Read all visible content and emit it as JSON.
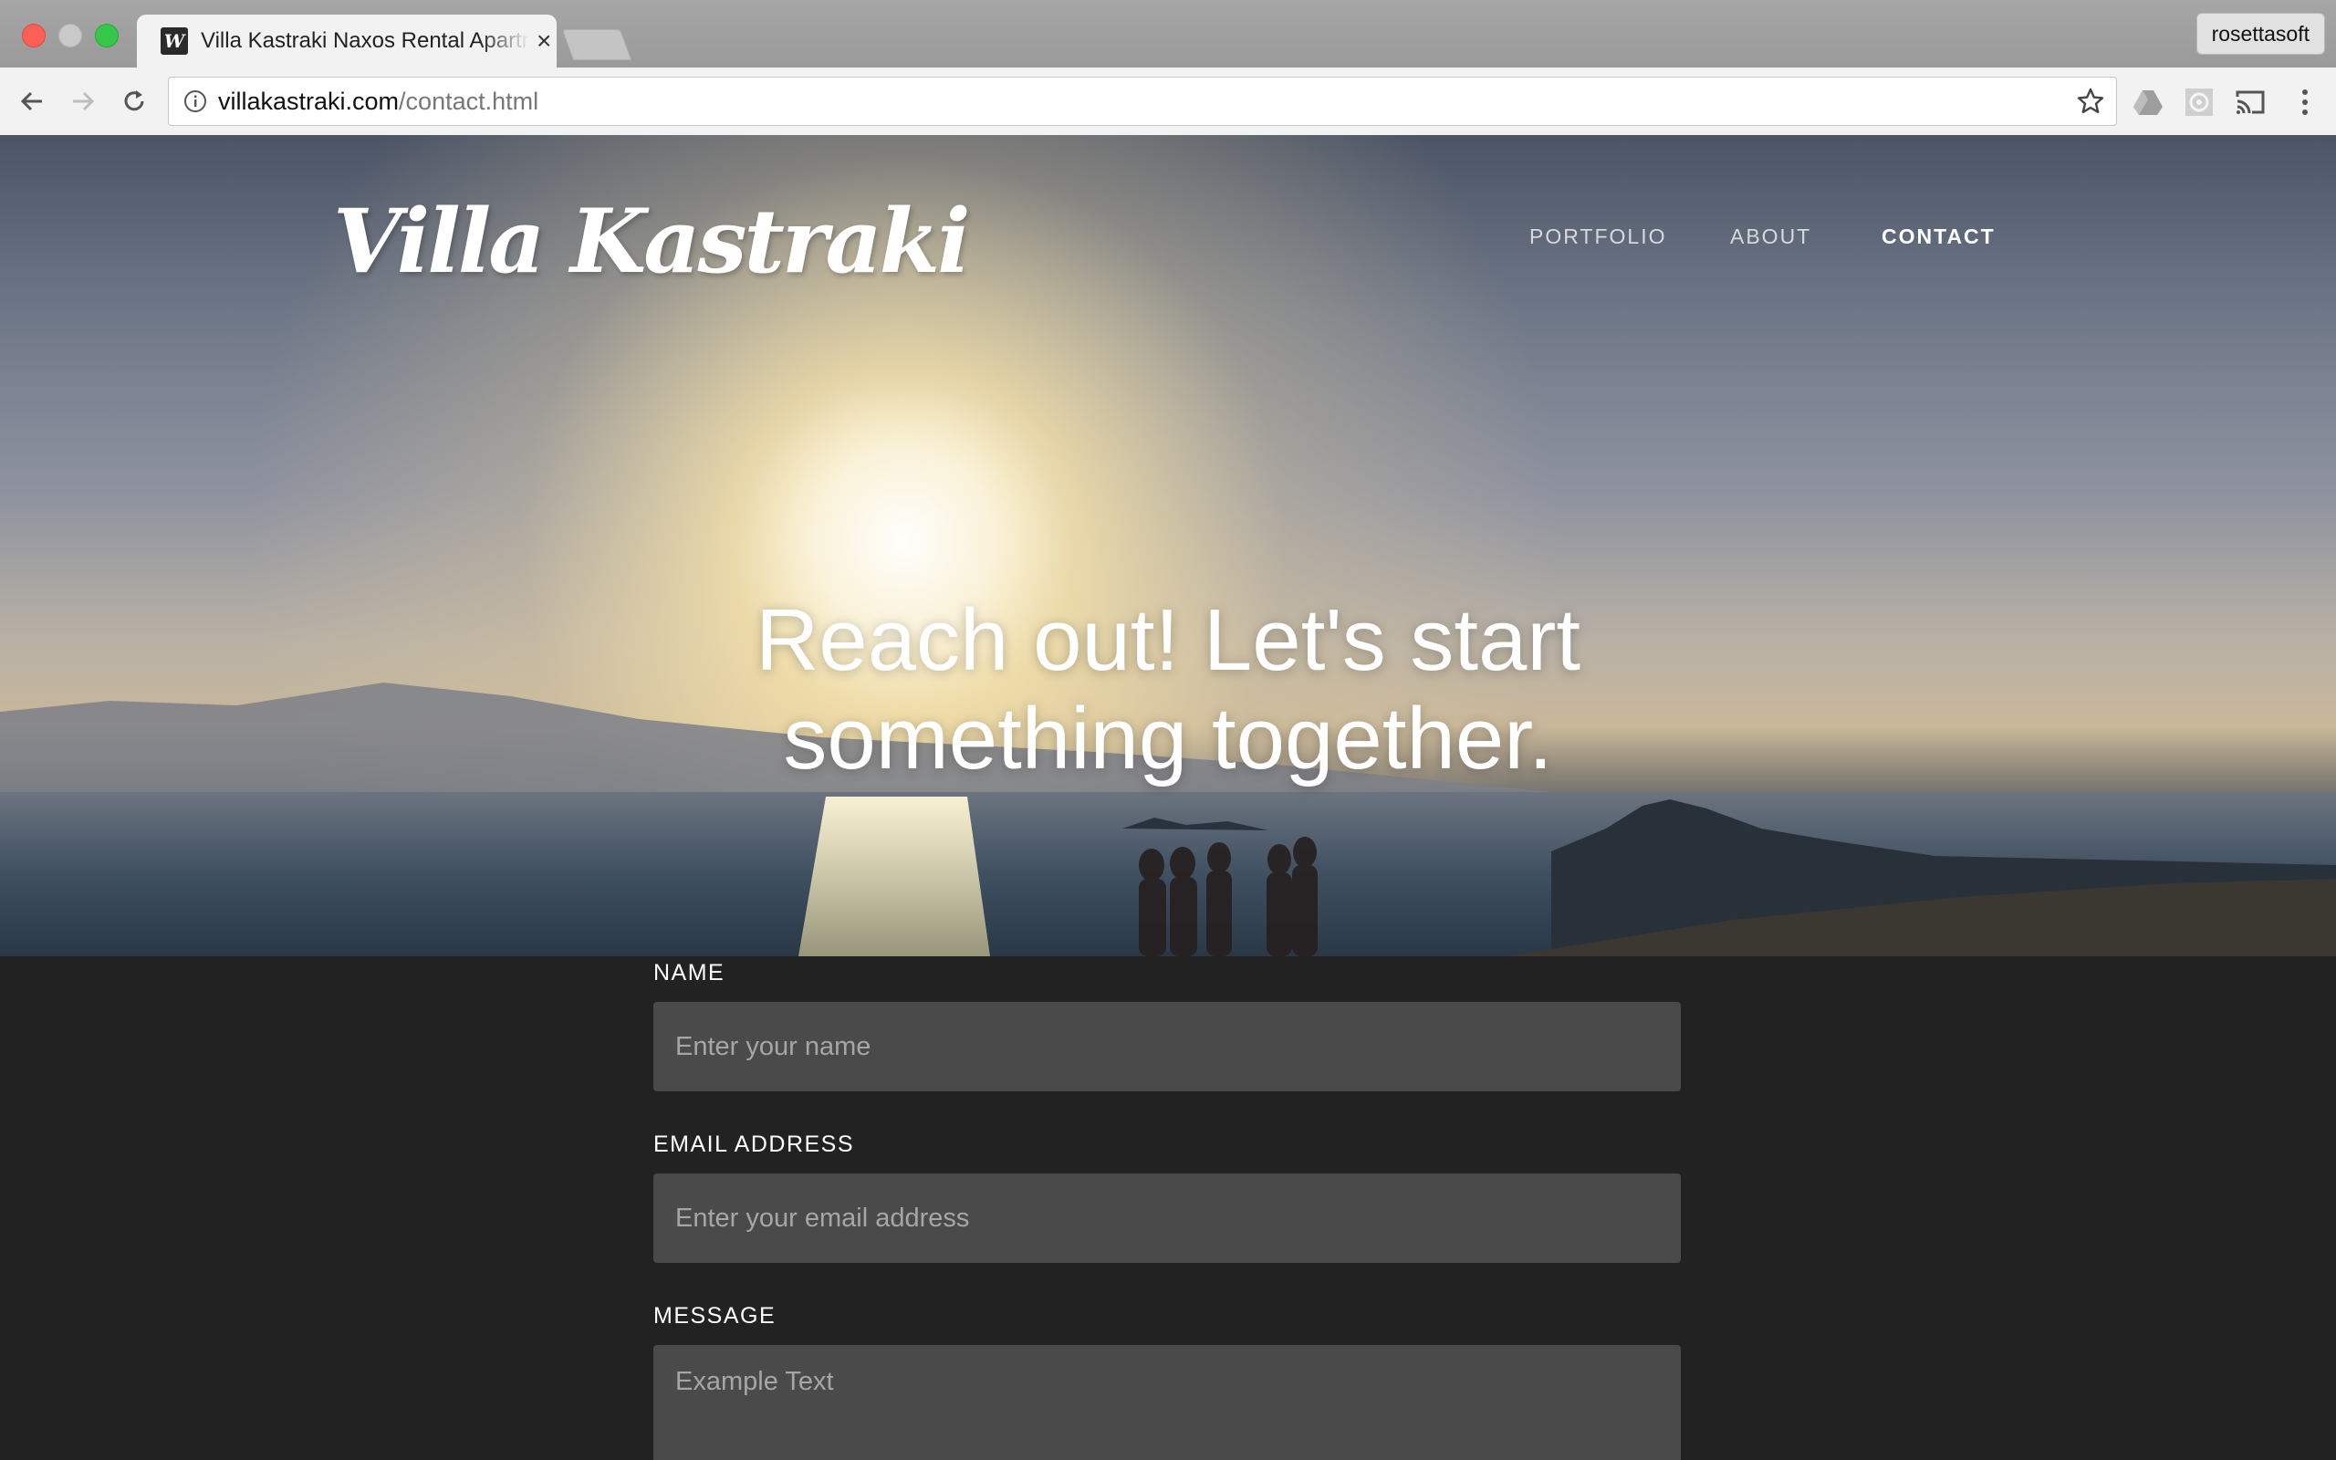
{
  "browser": {
    "tab_title": "Villa Kastraki Naxos Rental Apartments",
    "tab_favicon_letter": "W",
    "url_host": "villakastraki.com",
    "url_path": "/contact.html",
    "profile_name": "rosettasoft"
  },
  "site": {
    "logo": "Villa Kastraki",
    "nav": {
      "portfolio": "PORTFOLIO",
      "about": "ABOUT",
      "contact": "CONTACT"
    },
    "hero_line1": "Reach out! Let's start",
    "hero_line2": "something together."
  },
  "form": {
    "name_label": "NAME",
    "name_placeholder": "Enter your name",
    "email_label": "EMAIL ADDRESS",
    "email_placeholder": "Enter your email address",
    "message_label": "MESSAGE",
    "message_placeholder": "Example Text"
  },
  "colors": {
    "page_background": "#222222",
    "input_background": "#4a4a4a",
    "nav_active": "#ffffff",
    "nav_inactive": "#d9d9dd"
  }
}
